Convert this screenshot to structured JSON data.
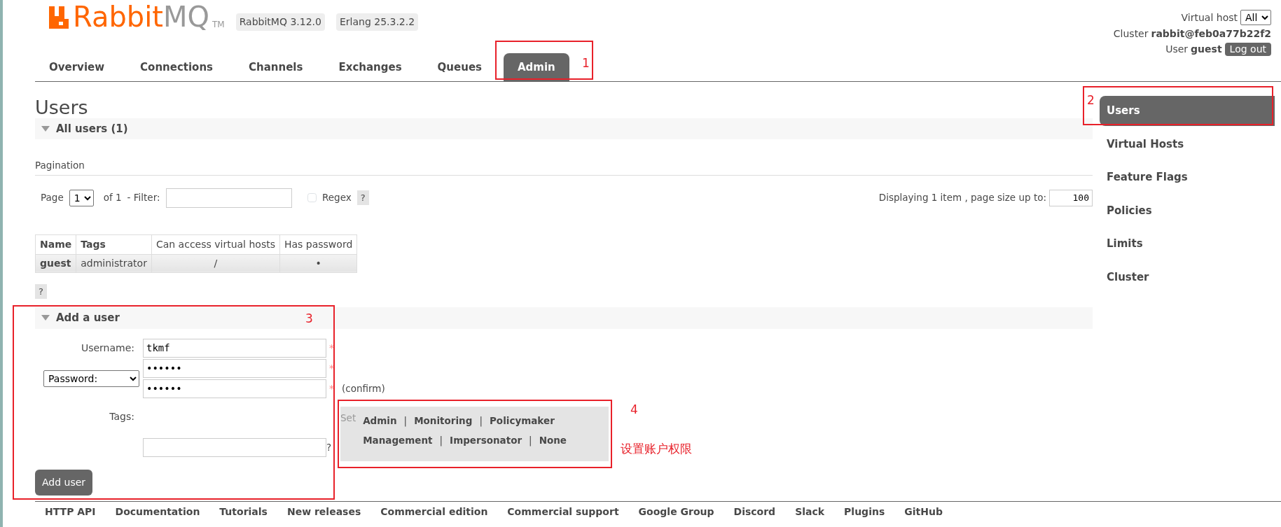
{
  "header": {
    "logo": {
      "brand": "Rabbit",
      "suffix": "MQ",
      "trademark": "TM"
    },
    "versions": [
      "RabbitMQ 3.12.0",
      "Erlang 25.3.2.2"
    ],
    "virtual_host": {
      "label": "Virtual host",
      "value": "All"
    },
    "cluster": {
      "label": "Cluster",
      "value": "rabbit@feb0a77b22f2"
    },
    "user": {
      "label": "User",
      "value": "guest"
    },
    "logout": "Log out"
  },
  "tabs": [
    {
      "label": "Overview",
      "selected": false
    },
    {
      "label": "Connections",
      "selected": false
    },
    {
      "label": "Channels",
      "selected": false
    },
    {
      "label": "Exchanges",
      "selected": false
    },
    {
      "label": "Queues",
      "selected": false
    },
    {
      "label": "Admin",
      "selected": true
    }
  ],
  "sidebar": {
    "items": [
      {
        "label": "Users",
        "selected": true
      },
      {
        "label": "Virtual Hosts",
        "selected": false
      },
      {
        "label": "Feature Flags",
        "selected": false
      },
      {
        "label": "Policies",
        "selected": false
      },
      {
        "label": "Limits",
        "selected": false
      },
      {
        "label": "Cluster",
        "selected": false
      }
    ]
  },
  "page_title": "Users",
  "all_users": {
    "title": "All users (1)",
    "expanded": true
  },
  "pagination": {
    "heading": "Pagination",
    "page_label": "Page",
    "page_value": "1",
    "of": "of 1",
    "filter_label": "- Filter:",
    "regex_label": "Regex",
    "regex_checked": false,
    "help": "?",
    "displaying": "Displaying 1 item , page size up to:",
    "page_size": "100"
  },
  "table": {
    "columns": [
      "Name",
      "Tags",
      "Can access virtual hosts",
      "Has password"
    ],
    "rows": [
      {
        "cells": [
          "guest",
          "administrator",
          "/",
          "•"
        ]
      }
    ],
    "help": "?"
  },
  "add_user": {
    "title": "Add a user",
    "expanded": true,
    "username": {
      "label": "Username:",
      "value": "tkmf",
      "required_mark": "*"
    },
    "password": {
      "mode": "Password:",
      "value": "••••••",
      "required_mark": "*"
    },
    "confirm": {
      "value": "••••••",
      "required_mark": "*",
      "note": "(confirm)"
    },
    "tags": {
      "label": "Tags:",
      "help": "?",
      "set_label": "Set",
      "lines": [
        [
          {
            "text": "Admin",
            "separator": "|"
          },
          {
            "text": "Monitoring",
            "separator": "|"
          },
          {
            "text": "Policymaker"
          }
        ],
        [
          {
            "text": "Management",
            "separator": "|"
          },
          {
            "text": "Impersonator",
            "separator": "|"
          },
          {
            "text": "None"
          }
        ]
      ]
    },
    "submit": "Add user"
  },
  "footer": {
    "links": [
      "HTTP API",
      "Documentation",
      "Tutorials",
      "New releases",
      "Commercial edition",
      "Commercial support",
      "Google Group",
      "Discord",
      "Slack",
      "Plugins",
      "GitHub"
    ]
  },
  "annotations": [
    {
      "label": "1"
    },
    {
      "label": "2"
    },
    {
      "label": "3"
    },
    {
      "label": "4",
      "note": "设置账户权限"
    }
  ]
}
